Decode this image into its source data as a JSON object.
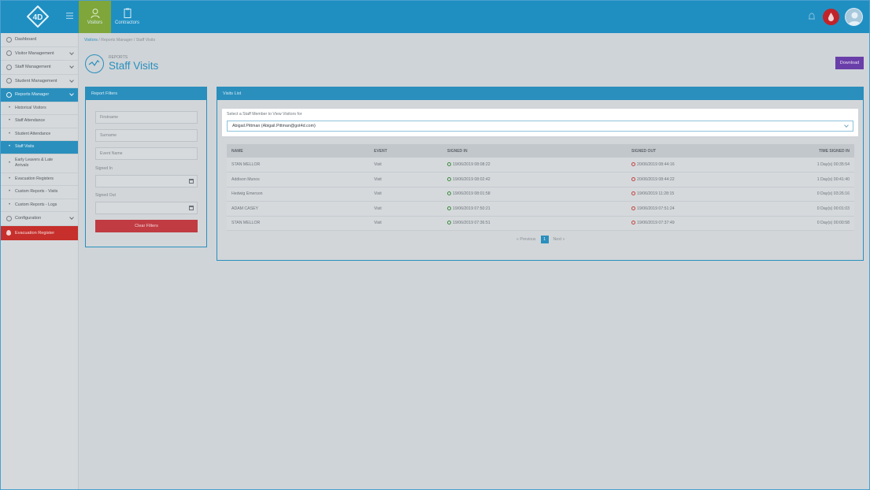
{
  "brand": {
    "logo_text": "4D"
  },
  "topnav": {
    "tabs": [
      {
        "label": "Visitors",
        "active": true
      },
      {
        "label": "Contractors",
        "active": false
      }
    ],
    "accent": "#1f8fc2",
    "active_tab_color": "#7fa63a"
  },
  "sidebar": {
    "items": [
      {
        "label": "Dashboard",
        "icon": "dashboard-icon",
        "expandable": false
      },
      {
        "label": "Visitor Management",
        "icon": "user-icon",
        "expandable": true
      },
      {
        "label": "Staff Management",
        "icon": "staff-icon",
        "expandable": true
      },
      {
        "label": "Student Management",
        "icon": "student-icon",
        "expandable": true
      },
      {
        "label": "Reports Manager",
        "icon": "reports-icon",
        "expandable": true
      }
    ],
    "sub_items": [
      {
        "label": "Historical Visitors"
      },
      {
        "label": "Staff Attendance"
      },
      {
        "label": "Student Attendance"
      },
      {
        "label": "Staff Visits"
      },
      {
        "label": "Early Leavers & Late Arrivals"
      },
      {
        "label": "Evacuation Registers"
      },
      {
        "label": "Custom Reports - Visits"
      },
      {
        "label": "Custom Reports - Logs"
      }
    ],
    "config_label": "Configuration",
    "evacuation_label": "Evacuation Register",
    "evacuation_color": "#c62f2b"
  },
  "breadcrumb": {
    "items": [
      "Visitors",
      "Reports Manager",
      "Staff Visits"
    ],
    "sep": "/"
  },
  "page": {
    "subtitle": "REPORTS",
    "title": "Staff Visits",
    "download_label": "Download"
  },
  "filters": {
    "header": "Report Filters",
    "firstname_placeholder": "Firstname",
    "surname_placeholder": "Surname",
    "event_placeholder": "Event Name",
    "signed_in_label": "Signed In",
    "signed_out_label": "Signed Out",
    "clear_label": "Clear Filters"
  },
  "visits": {
    "header": "Visits List",
    "select_label": "Select a Staff Member to View Visitors for",
    "selected_staff": "Abigail.Pittman (Abigail.Pittman@got4d.com)",
    "columns": [
      "NAME",
      "EVENT",
      "SIGNED IN",
      "SIGNED OUT",
      "TIME SIGNED IN"
    ],
    "rows": [
      {
        "name": "STAN MELLOR",
        "event": "Visit",
        "signed_in": "19/06/2019 08:08:22",
        "signed_out": "20/06/2019 08:44:16",
        "time": "1 Day(s) 00:35:54"
      },
      {
        "name": "Addison Munos",
        "event": "Visit",
        "signed_in": "19/06/2019 08:02:42",
        "signed_out": "20/06/2019 08:44:22",
        "time": "1 Day(s) 00:41:40"
      },
      {
        "name": "Hedwig Emerson",
        "event": "Visit",
        "signed_in": "19/06/2019 08:01:58",
        "signed_out": "19/06/2019 11:28:15",
        "time": "0 Day(s) 03:26:16"
      },
      {
        "name": "ADAM CASEY",
        "event": "Visit",
        "signed_in": "19/06/2019 07:50:21",
        "signed_out": "19/06/2019 07:51:24",
        "time": "0 Day(s) 00:01:03"
      },
      {
        "name": "STAN MELLOR",
        "event": "Visit",
        "signed_in": "19/06/2019 07:36:51",
        "signed_out": "19/06/2019 07:37:49",
        "time": "0 Day(s) 00:00:58"
      }
    ]
  },
  "pagination": {
    "previous": "Previous",
    "current": "1",
    "next": "Next"
  }
}
